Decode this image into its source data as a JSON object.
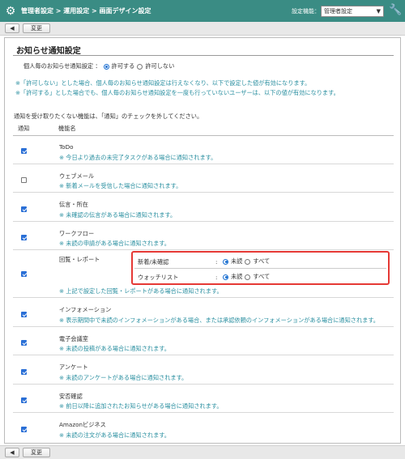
{
  "titlebar": {
    "breadcrumb": "管理者設定 > 運用設定 > 画面デザイン設定",
    "function_label": "設定機能：",
    "function_value": "管理者設定"
  },
  "toolbar": {
    "back_label": "◀",
    "change_label": "変更"
  },
  "panel": {
    "title": "お知らせ通知設定",
    "setting_label": "個人毎のお知らせ通知設定 ：",
    "opt_allow": "許可する",
    "opt_deny": "許可しない",
    "note1": "※「許可しない」とした場合、個人毎のお知らせ通知設定は行えなくなり、以下で設定した値が有効になります。",
    "note2": "※「許可する」とした場合でも、個人毎のお知らせ通知設定を一度も行っていないユーザーは、以下の値が有効になります。",
    "intro": "通知を受け取りたくない機能は、「通知」のチェックを外してください。",
    "col_notify": "通知",
    "col_function": "機能名"
  },
  "rows": [
    {
      "name": "ToDo",
      "desc": "※ 今日より過去の未完了タスクがある場合に通知されます。",
      "checked": true
    },
    {
      "name": "ウェブメール",
      "desc": "※ 新着メールを受信した場合に通知されます。",
      "checked": false
    },
    {
      "name": "伝言・所在",
      "desc": "※ 未確認の伝言がある場合に通知されます。",
      "checked": true
    },
    {
      "name": "ワークフロー",
      "desc": "※ 未読の申請がある場合に通知されます。",
      "checked": true
    },
    {
      "name": "回覧・レポート",
      "desc": "※ 上記で設定した回覧・レポートがある場合に通知されます。",
      "checked": true
    },
    {
      "name": "インフォメーション",
      "desc": "※ 表示期間中で未読のインフォメーションがある場合、または承認依頼のインフォメーションがある場合に通知されます。",
      "checked": true
    },
    {
      "name": "電子会議室",
      "desc": "※ 未読の投稿がある場合に通知されます。",
      "checked": true
    },
    {
      "name": "アンケート",
      "desc": "※ 未読のアンケートがある場合に通知されます。",
      "checked": true
    },
    {
      "name": "安否確認",
      "desc": "※ 前日以降に追加されたお知らせがある場合に通知されます。",
      "checked": true
    },
    {
      "name": "Amazonビジネス",
      "desc": "※ 未読の注文がある場合に通知されます。",
      "checked": true
    }
  ],
  "circular_sub": {
    "row1_label": "新着/未確認",
    "row2_label": "ウォッチリスト",
    "colon": ":",
    "opt_unread": "未読",
    "opt_all": "すべて"
  }
}
